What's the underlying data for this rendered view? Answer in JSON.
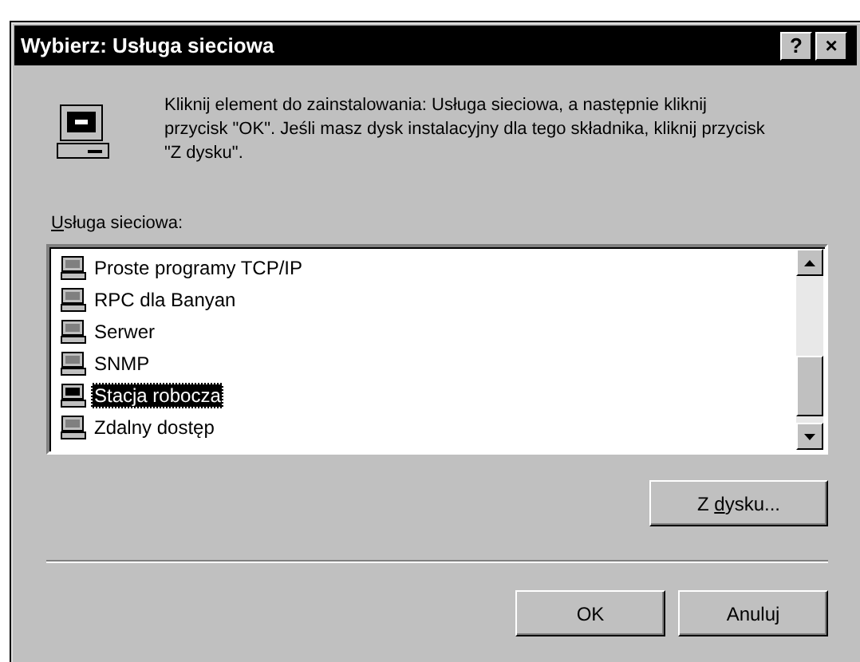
{
  "window": {
    "title": "Wybierz: Usługa sieciowa",
    "help_button": "?",
    "close_button": "×"
  },
  "instructions": "Kliknij element do zainstalowania: Usługa sieciowa, a następnie kliknij przycisk \"OK\".  Jeśli masz dysk instalacyjny dla tego składnika, kliknij przycisk \"Z dysku\".",
  "list_label": [
    {
      "text": "U",
      "underlined": true
    },
    {
      "text": "sługa sieciowa:",
      "underlined": false
    }
  ],
  "items": [
    {
      "label": "Proste programy TCP/IP",
      "selected": false
    },
    {
      "label": "RPC dla Banyan",
      "selected": false
    },
    {
      "label": "Serwer",
      "selected": false
    },
    {
      "label": "SNMP",
      "selected": false
    },
    {
      "label": "Stacja robocza",
      "selected": true
    },
    {
      "label": "Zdalny dostęp",
      "selected": false
    }
  ],
  "have_disk_button": [
    {
      "text": "Z ",
      "underlined": false
    },
    {
      "text": "d",
      "underlined": true
    },
    {
      "text": "ysku...",
      "underlined": false
    }
  ],
  "buttons": [
    "OK",
    "Anuluj"
  ]
}
